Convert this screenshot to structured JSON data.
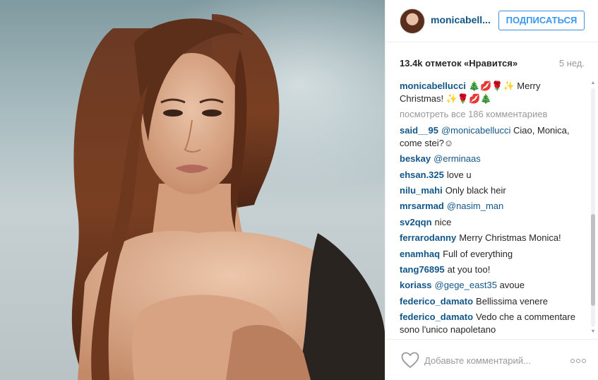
{
  "post": {
    "photo_alt": "",
    "colors": {
      "username": "#125688",
      "follow": "#3897f0",
      "muted": "#999999",
      "text": "#262626"
    }
  },
  "header": {
    "username": "monicabell...",
    "follow_label": "ПОДПИСАТЬСЯ"
  },
  "stats": {
    "likes": "13.4k отметок «Нравится»",
    "time": "5 нед."
  },
  "caption": {
    "user": "monicabellucci",
    "text": "🎄💋🌹✨ Merry Christmas! ✨🌹💋🎄"
  },
  "view_all": "посмотреть все 186 комментариев",
  "comments": [
    {
      "user": "said__95",
      "mention": "@monicabellucci",
      "text": "Ciao, Monica, come stei?☺"
    },
    {
      "user": "beskay",
      "mention": "@erminaas",
      "text": ""
    },
    {
      "user": "ehsan.325",
      "mention": "",
      "text": "love u"
    },
    {
      "user": "nilu_mahi",
      "mention": "",
      "text": "Only black heir"
    },
    {
      "user": "mrsarmad",
      "mention": "@nasim_man",
      "text": ""
    },
    {
      "user": "sv2qqn",
      "mention": "",
      "text": "nice"
    },
    {
      "user": "ferrarodanny",
      "mention": "",
      "text": "Merry Christmas Monica!"
    },
    {
      "user": "enamhaq",
      "mention": "",
      "text": "Full of everything"
    },
    {
      "user": "tang76895",
      "mention": "",
      "text": "at you too!"
    },
    {
      "user": "koriass",
      "mention": "@gege_east35",
      "text": "avoue"
    },
    {
      "user": "federico_damato",
      "mention": "",
      "text": "Bellissima venere"
    },
    {
      "user": "federico_damato",
      "mention": "",
      "text": "Vedo che a commentare sono l'unico napoletano"
    }
  ],
  "footer": {
    "comment_placeholder": "Добавьте комментарий...",
    "like_icon": "heart-icon",
    "more_icon": "more-options-icon"
  }
}
